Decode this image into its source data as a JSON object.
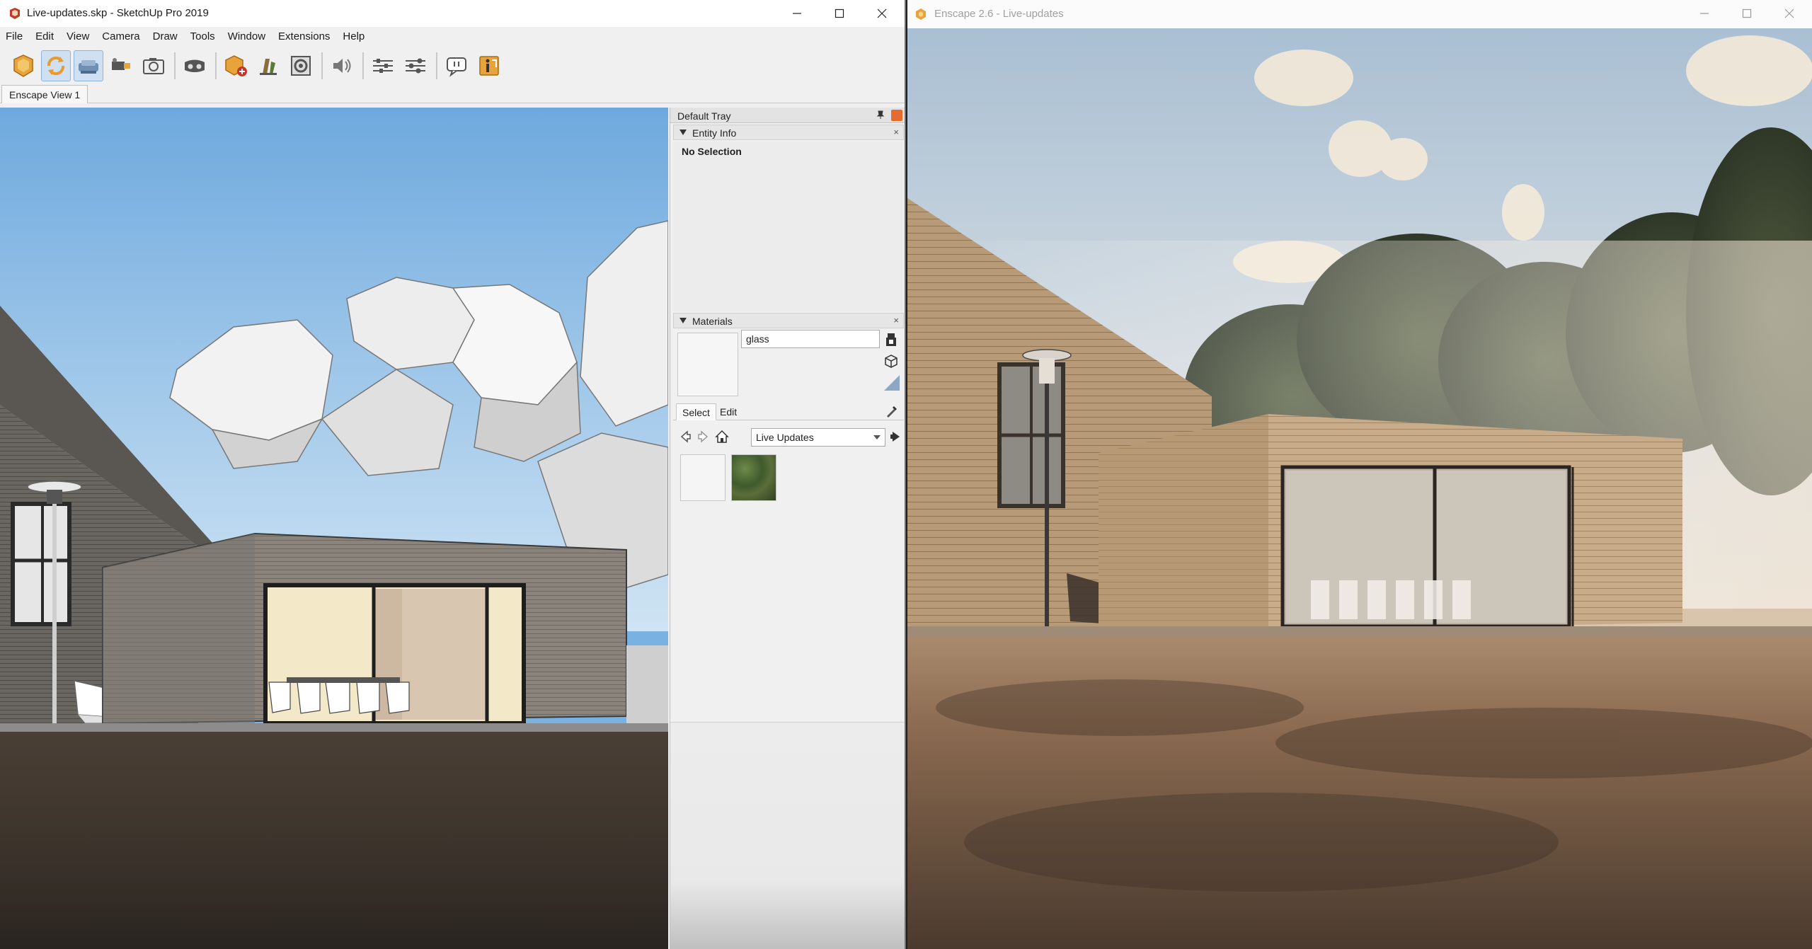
{
  "sketchup": {
    "title": "Live-updates.skp - SketchUp Pro 2019",
    "menu": [
      "File",
      "Edit",
      "View",
      "Camera",
      "Draw",
      "Tools",
      "Window",
      "Extensions",
      "Help"
    ],
    "toolbar_icons": [
      "enscape-start-icon",
      "live-update-icon",
      "sync-views-icon",
      "video-editor-icon",
      "screenshot-icon",
      "vr-headset-icon",
      "create-asset-icon",
      "asset-library-icon",
      "batch-render-icon",
      "audio-icon",
      "settings-icon",
      "visual-settings-icon",
      "feedback-icon",
      "about-icon"
    ],
    "scene_tab": "Enscape View 1",
    "tray": {
      "title": "Default Tray",
      "entity_info": {
        "header": "Entity Info",
        "selection": "No Selection"
      },
      "materials": {
        "header": "Materials",
        "name_value": "glass",
        "tabs": [
          "Select",
          "Edit"
        ],
        "active_tab": "Select",
        "collection": "Live Updates"
      }
    }
  },
  "enscape": {
    "title": "Enscape 2.6 - Live-updates"
  },
  "colors": {
    "enscape_accent": "#e8a33a",
    "tray_close": "#e56b2f",
    "sky": "#79b2e2"
  }
}
